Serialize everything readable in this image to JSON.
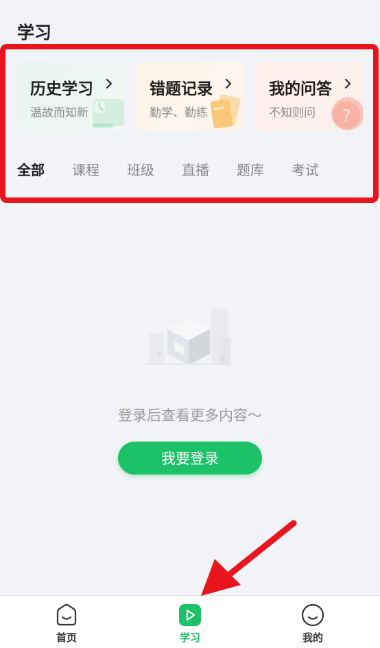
{
  "header": {
    "title": "学习"
  },
  "cards": [
    {
      "title": "历史学习",
      "subtitle": "温故而知新",
      "chevron": "chevron-right-icon",
      "deco": "clock-icon"
    },
    {
      "title": "错题记录",
      "subtitle": "勤学、勤练",
      "chevron": "chevron-right-icon",
      "deco": "notebook-icon"
    },
    {
      "title": "我的问答",
      "subtitle": "不知则问",
      "chevron": "chevron-right-icon",
      "deco": "question-icon"
    }
  ],
  "tabs": [
    {
      "label": "全部",
      "active": true
    },
    {
      "label": "课程"
    },
    {
      "label": "班级"
    },
    {
      "label": "直播"
    },
    {
      "label": "题库"
    },
    {
      "label": "考试"
    }
  ],
  "empty_state": {
    "message": "登录后查看更多内容～",
    "login_button": "我要登录",
    "illustration": "empty-box-icon"
  },
  "bottom_nav": [
    {
      "label": "首页",
      "icon": "home-icon"
    },
    {
      "label": "学习",
      "icon": "play-icon",
      "active": true
    },
    {
      "label": "我的",
      "icon": "profile-icon"
    }
  ],
  "colors": {
    "accent": "#1dc167",
    "highlight": "#e8151f",
    "background": "#f1f3f6"
  }
}
